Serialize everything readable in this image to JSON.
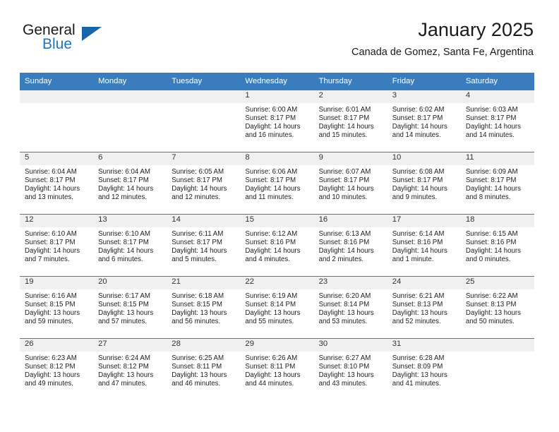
{
  "brand": {
    "word_general": "General",
    "word_blue": "Blue",
    "triangle_color": "#1565a8",
    "blue_color": "#2175c0"
  },
  "header": {
    "title": "January 2025",
    "subtitle": "Canada de Gomez, Santa Fe, Argentina"
  },
  "theme": {
    "header_band": "#3a7dbf",
    "daynum_band": "#f0f0f0",
    "text": "#222222"
  },
  "weekdays": [
    "Sunday",
    "Monday",
    "Tuesday",
    "Wednesday",
    "Thursday",
    "Friday",
    "Saturday"
  ],
  "weeks": [
    [
      {
        "day": "",
        "sunrise": "",
        "sunset": "",
        "daylight1": "",
        "daylight2": ""
      },
      {
        "day": "",
        "sunrise": "",
        "sunset": "",
        "daylight1": "",
        "daylight2": ""
      },
      {
        "day": "",
        "sunrise": "",
        "sunset": "",
        "daylight1": "",
        "daylight2": ""
      },
      {
        "day": "1",
        "sunrise": "Sunrise: 6:00 AM",
        "sunset": "Sunset: 8:17 PM",
        "daylight1": "Daylight: 14 hours",
        "daylight2": "and 16 minutes."
      },
      {
        "day": "2",
        "sunrise": "Sunrise: 6:01 AM",
        "sunset": "Sunset: 8:17 PM",
        "daylight1": "Daylight: 14 hours",
        "daylight2": "and 15 minutes."
      },
      {
        "day": "3",
        "sunrise": "Sunrise: 6:02 AM",
        "sunset": "Sunset: 8:17 PM",
        "daylight1": "Daylight: 14 hours",
        "daylight2": "and 14 minutes."
      },
      {
        "day": "4",
        "sunrise": "Sunrise: 6:03 AM",
        "sunset": "Sunset: 8:17 PM",
        "daylight1": "Daylight: 14 hours",
        "daylight2": "and 14 minutes."
      }
    ],
    [
      {
        "day": "5",
        "sunrise": "Sunrise: 6:04 AM",
        "sunset": "Sunset: 8:17 PM",
        "daylight1": "Daylight: 14 hours",
        "daylight2": "and 13 minutes."
      },
      {
        "day": "6",
        "sunrise": "Sunrise: 6:04 AM",
        "sunset": "Sunset: 8:17 PM",
        "daylight1": "Daylight: 14 hours",
        "daylight2": "and 12 minutes."
      },
      {
        "day": "7",
        "sunrise": "Sunrise: 6:05 AM",
        "sunset": "Sunset: 8:17 PM",
        "daylight1": "Daylight: 14 hours",
        "daylight2": "and 12 minutes."
      },
      {
        "day": "8",
        "sunrise": "Sunrise: 6:06 AM",
        "sunset": "Sunset: 8:17 PM",
        "daylight1": "Daylight: 14 hours",
        "daylight2": "and 11 minutes."
      },
      {
        "day": "9",
        "sunrise": "Sunrise: 6:07 AM",
        "sunset": "Sunset: 8:17 PM",
        "daylight1": "Daylight: 14 hours",
        "daylight2": "and 10 minutes."
      },
      {
        "day": "10",
        "sunrise": "Sunrise: 6:08 AM",
        "sunset": "Sunset: 8:17 PM",
        "daylight1": "Daylight: 14 hours",
        "daylight2": "and 9 minutes."
      },
      {
        "day": "11",
        "sunrise": "Sunrise: 6:09 AM",
        "sunset": "Sunset: 8:17 PM",
        "daylight1": "Daylight: 14 hours",
        "daylight2": "and 8 minutes."
      }
    ],
    [
      {
        "day": "12",
        "sunrise": "Sunrise: 6:10 AM",
        "sunset": "Sunset: 8:17 PM",
        "daylight1": "Daylight: 14 hours",
        "daylight2": "and 7 minutes."
      },
      {
        "day": "13",
        "sunrise": "Sunrise: 6:10 AM",
        "sunset": "Sunset: 8:17 PM",
        "daylight1": "Daylight: 14 hours",
        "daylight2": "and 6 minutes."
      },
      {
        "day": "14",
        "sunrise": "Sunrise: 6:11 AM",
        "sunset": "Sunset: 8:17 PM",
        "daylight1": "Daylight: 14 hours",
        "daylight2": "and 5 minutes."
      },
      {
        "day": "15",
        "sunrise": "Sunrise: 6:12 AM",
        "sunset": "Sunset: 8:16 PM",
        "daylight1": "Daylight: 14 hours",
        "daylight2": "and 4 minutes."
      },
      {
        "day": "16",
        "sunrise": "Sunrise: 6:13 AM",
        "sunset": "Sunset: 8:16 PM",
        "daylight1": "Daylight: 14 hours",
        "daylight2": "and 2 minutes."
      },
      {
        "day": "17",
        "sunrise": "Sunrise: 6:14 AM",
        "sunset": "Sunset: 8:16 PM",
        "daylight1": "Daylight: 14 hours",
        "daylight2": "and 1 minute."
      },
      {
        "day": "18",
        "sunrise": "Sunrise: 6:15 AM",
        "sunset": "Sunset: 8:16 PM",
        "daylight1": "Daylight: 14 hours",
        "daylight2": "and 0 minutes."
      }
    ],
    [
      {
        "day": "19",
        "sunrise": "Sunrise: 6:16 AM",
        "sunset": "Sunset: 8:15 PM",
        "daylight1": "Daylight: 13 hours",
        "daylight2": "and 59 minutes."
      },
      {
        "day": "20",
        "sunrise": "Sunrise: 6:17 AM",
        "sunset": "Sunset: 8:15 PM",
        "daylight1": "Daylight: 13 hours",
        "daylight2": "and 57 minutes."
      },
      {
        "day": "21",
        "sunrise": "Sunrise: 6:18 AM",
        "sunset": "Sunset: 8:15 PM",
        "daylight1": "Daylight: 13 hours",
        "daylight2": "and 56 minutes."
      },
      {
        "day": "22",
        "sunrise": "Sunrise: 6:19 AM",
        "sunset": "Sunset: 8:14 PM",
        "daylight1": "Daylight: 13 hours",
        "daylight2": "and 55 minutes."
      },
      {
        "day": "23",
        "sunrise": "Sunrise: 6:20 AM",
        "sunset": "Sunset: 8:14 PM",
        "daylight1": "Daylight: 13 hours",
        "daylight2": "and 53 minutes."
      },
      {
        "day": "24",
        "sunrise": "Sunrise: 6:21 AM",
        "sunset": "Sunset: 8:13 PM",
        "daylight1": "Daylight: 13 hours",
        "daylight2": "and 52 minutes."
      },
      {
        "day": "25",
        "sunrise": "Sunrise: 6:22 AM",
        "sunset": "Sunset: 8:13 PM",
        "daylight1": "Daylight: 13 hours",
        "daylight2": "and 50 minutes."
      }
    ],
    [
      {
        "day": "26",
        "sunrise": "Sunrise: 6:23 AM",
        "sunset": "Sunset: 8:12 PM",
        "daylight1": "Daylight: 13 hours",
        "daylight2": "and 49 minutes."
      },
      {
        "day": "27",
        "sunrise": "Sunrise: 6:24 AM",
        "sunset": "Sunset: 8:12 PM",
        "daylight1": "Daylight: 13 hours",
        "daylight2": "and 47 minutes."
      },
      {
        "day": "28",
        "sunrise": "Sunrise: 6:25 AM",
        "sunset": "Sunset: 8:11 PM",
        "daylight1": "Daylight: 13 hours",
        "daylight2": "and 46 minutes."
      },
      {
        "day": "29",
        "sunrise": "Sunrise: 6:26 AM",
        "sunset": "Sunset: 8:11 PM",
        "daylight1": "Daylight: 13 hours",
        "daylight2": "and 44 minutes."
      },
      {
        "day": "30",
        "sunrise": "Sunrise: 6:27 AM",
        "sunset": "Sunset: 8:10 PM",
        "daylight1": "Daylight: 13 hours",
        "daylight2": "and 43 minutes."
      },
      {
        "day": "31",
        "sunrise": "Sunrise: 6:28 AM",
        "sunset": "Sunset: 8:09 PM",
        "daylight1": "Daylight: 13 hours",
        "daylight2": "and 41 minutes."
      },
      {
        "day": "",
        "sunrise": "",
        "sunset": "",
        "daylight1": "",
        "daylight2": ""
      }
    ]
  ]
}
